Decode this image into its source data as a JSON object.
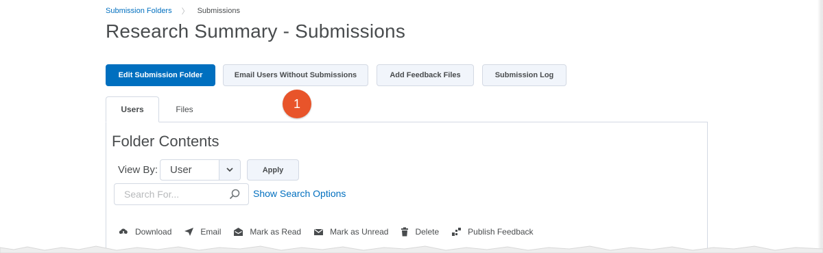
{
  "breadcrumb": {
    "items": [
      "Submission Folders",
      "Submissions"
    ]
  },
  "page": {
    "title": "Research Summary - Submissions"
  },
  "toolbar": {
    "edit_label": "Edit Submission Folder",
    "email_label": "Email Users Without Submissions",
    "feedback_label": "Add Feedback Files",
    "log_label": "Submission Log"
  },
  "callout": {
    "number": "1"
  },
  "tabs": [
    {
      "label": "Users",
      "active": true
    },
    {
      "label": "Files",
      "active": false
    }
  ],
  "folder": {
    "title": "Folder Contents",
    "view_by_label": "View By:",
    "view_by_value": "User",
    "apply_label": "Apply",
    "search_placeholder": "Search For...",
    "search_value": "",
    "show_options_label": "Show Search Options"
  },
  "actions": [
    {
      "label": "Download",
      "icon": "download-icon"
    },
    {
      "label": "Email",
      "icon": "send-icon"
    },
    {
      "label": "Mark as Read",
      "icon": "mail-open-icon"
    },
    {
      "label": "Mark as Unread",
      "icon": "mail-icon"
    },
    {
      "label": "Delete",
      "icon": "trash-icon"
    },
    {
      "label": "Publish Feedback",
      "icon": "publish-icon"
    }
  ],
  "colors": {
    "accent": "#006fbf",
    "callout": "#e8542a",
    "text": "#494c4e",
    "button_bg": "#f1f5fb",
    "border": "#d3d9e3"
  }
}
